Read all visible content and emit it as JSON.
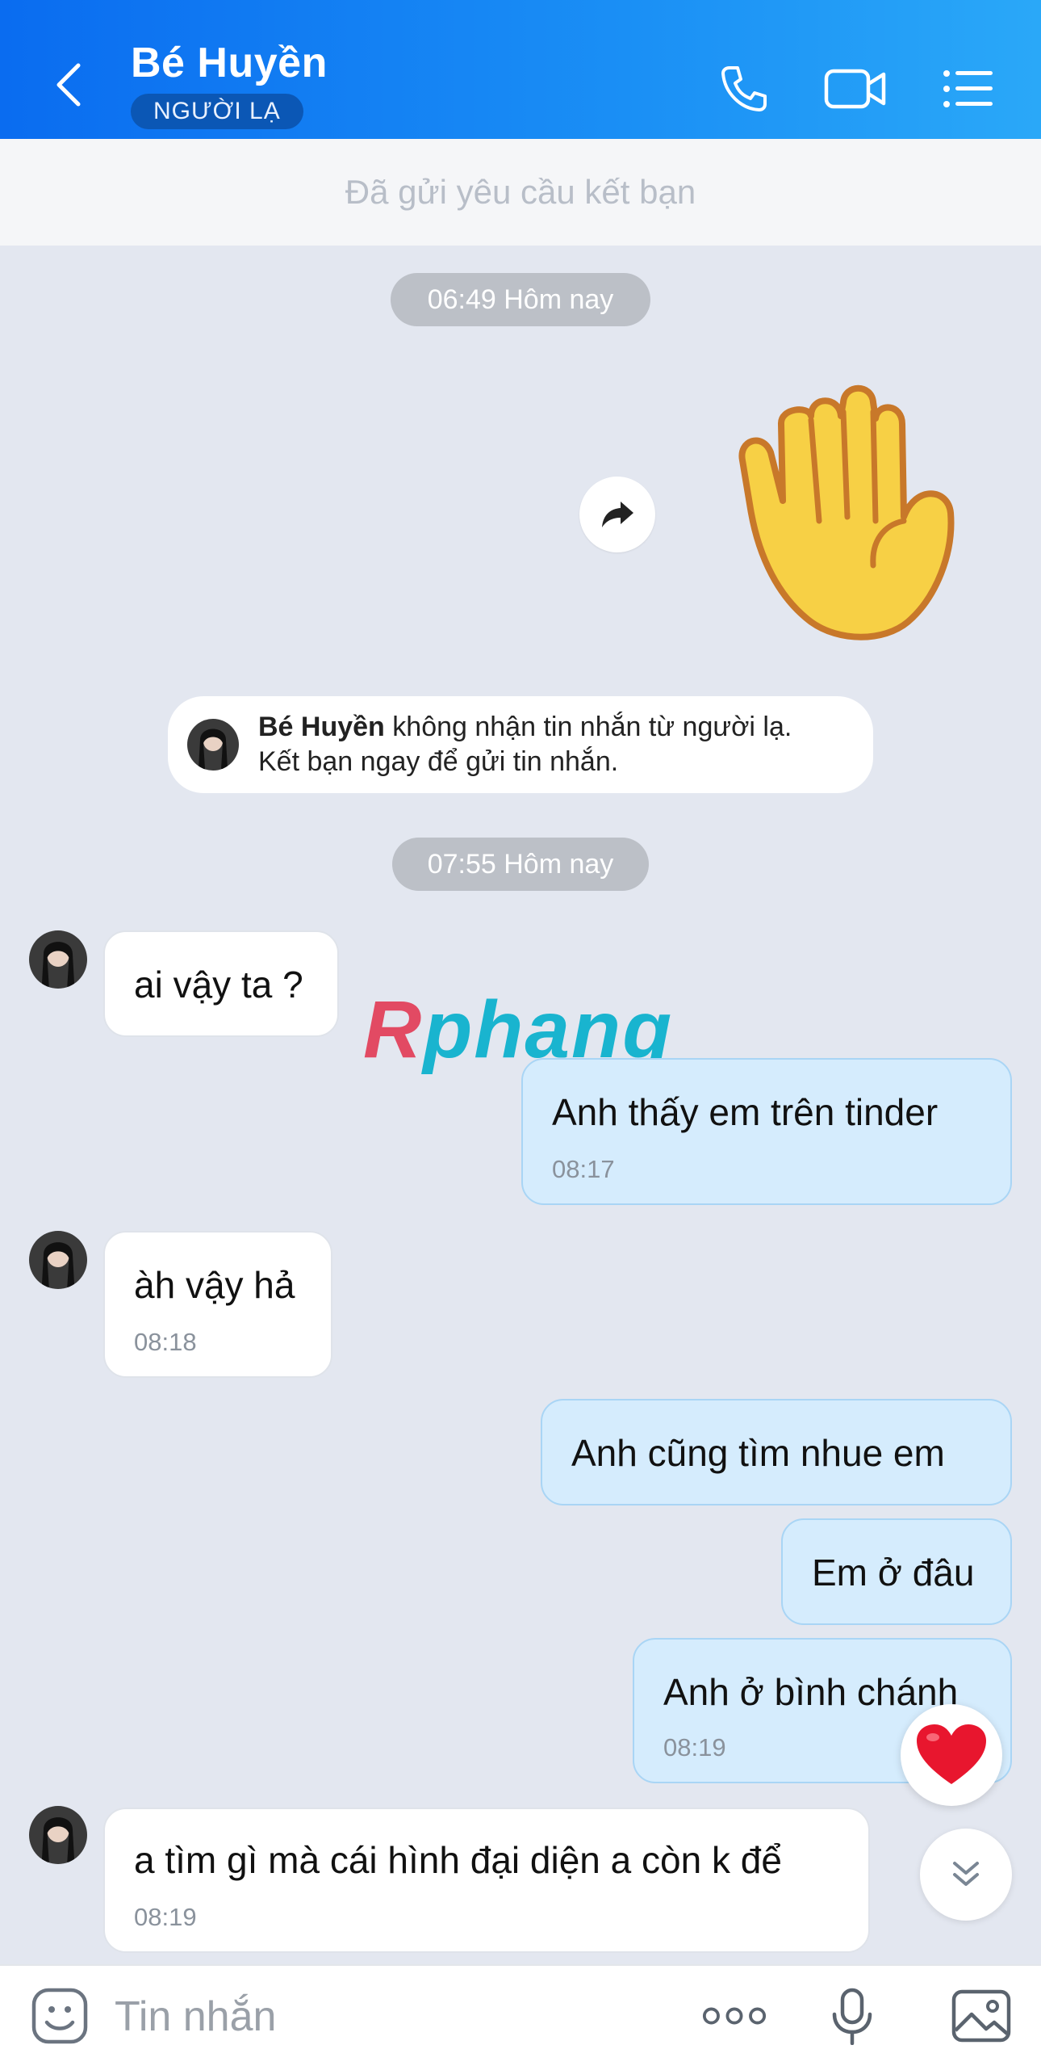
{
  "header": {
    "contact_name": "Bé Huyền",
    "status_badge": "NGƯỜI LẠ",
    "background": "#1280f2"
  },
  "friend_request_text": "Đã gửi yêu cầu kết bạn",
  "chat": {
    "time_separators": [
      "06:49 Hôm nay",
      "07:55 Hôm nay"
    ],
    "notice": {
      "name": "Bé Huyền",
      "line1": "không nhận tin nhắn từ người lạ.",
      "line2": "Kết bạn ngay để gửi tin nhắn."
    },
    "messages": [
      {
        "from": "them",
        "text": "ai vậy ta ?",
        "time": ""
      },
      {
        "from": "me",
        "text": "Anh thấy em trên tinder",
        "time": "08:17"
      },
      {
        "from": "them",
        "text": "àh vậy hả",
        "time": "08:18"
      },
      {
        "from": "me",
        "text": "Anh cũng tìm nhue em",
        "time": ""
      },
      {
        "from": "me",
        "text": "Em ở đâu",
        "time": ""
      },
      {
        "from": "me",
        "text": "Anh ở bình chánh",
        "time": "08:19"
      },
      {
        "from": "them",
        "text": "a tìm gì mà cái hình đại diện a còn k để",
        "time": "08:19"
      }
    ],
    "sticker": "raised-hand-emoji"
  },
  "watermark": {
    "part1": "R",
    "part2": "phang"
  },
  "composer": {
    "placeholder": "Tin nhắn"
  },
  "colors": {
    "header_start": "#0a6cf0",
    "header_end": "#2aa8f8",
    "chat_background": "#e3e7f0",
    "outgoing_bubble": "#d5ecfd",
    "incoming_bubble": "#ffffff"
  }
}
